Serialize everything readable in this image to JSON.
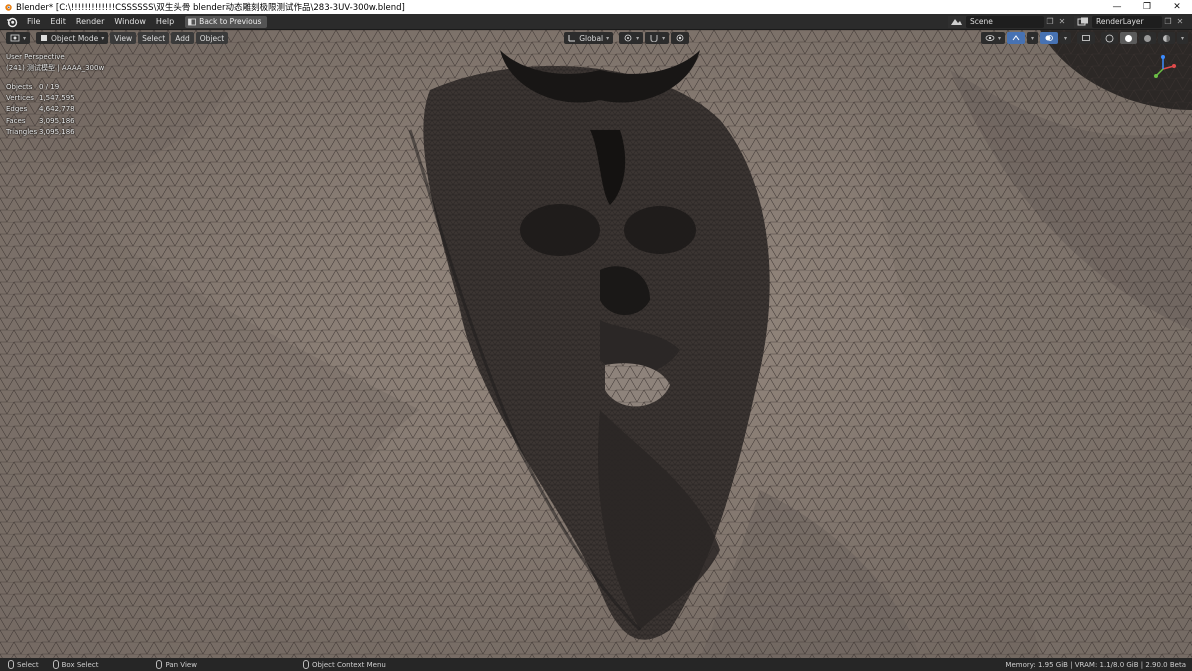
{
  "window": {
    "title": "Blender* [C:\\!!!!!!!!!!!!!CSSSSSS\\双生头骨  blender动态雕刻极限测试作品\\283-3UV-300w.blend]",
    "controls": [
      "—",
      "❐",
      "✕"
    ]
  },
  "menubar": {
    "items": [
      "File",
      "Edit",
      "Render",
      "Window",
      "Help"
    ],
    "back_button": "Back to Previous",
    "scene": "Scene",
    "render_layer": "RenderLayer"
  },
  "viewport_header": {
    "mode": "Object Mode",
    "menus": [
      "View",
      "Select",
      "Add",
      "Object"
    ],
    "transform_orientation": "Global"
  },
  "viewport": {
    "perspective": "User Perspective",
    "object_info": "(241) 测试模型 | AAAA_300w",
    "stats": [
      {
        "label": "Objects",
        "value": "0 / 19"
      },
      {
        "label": "Vertices",
        "value": "1,547,595"
      },
      {
        "label": "Edges",
        "value": "4,642,778"
      },
      {
        "label": "Faces",
        "value": "3,095,186"
      },
      {
        "label": "Triangles",
        "value": "3,095,186"
      }
    ]
  },
  "statusbar": {
    "select": "Select",
    "box_select": "Box Select",
    "pan_view": "Pan View",
    "context_menu": "Object Context Menu",
    "memory": "Memory: 1.95 GiB | VRAM: 1.1/8.0 GiB | 2.90.0 Beta"
  },
  "colors": {
    "mesh_base": "#857970",
    "wire": "#3a3330",
    "dense": "#2a2625",
    "header": "#2b2b2b",
    "accent": "#4772b3"
  },
  "icons": [
    "blender-logo-icon",
    "back-icon",
    "scene-icon",
    "renderlayer-icon",
    "mode-icon",
    "global-icon",
    "shading-icon",
    "gizmo-icon",
    "mouse-icon"
  ]
}
